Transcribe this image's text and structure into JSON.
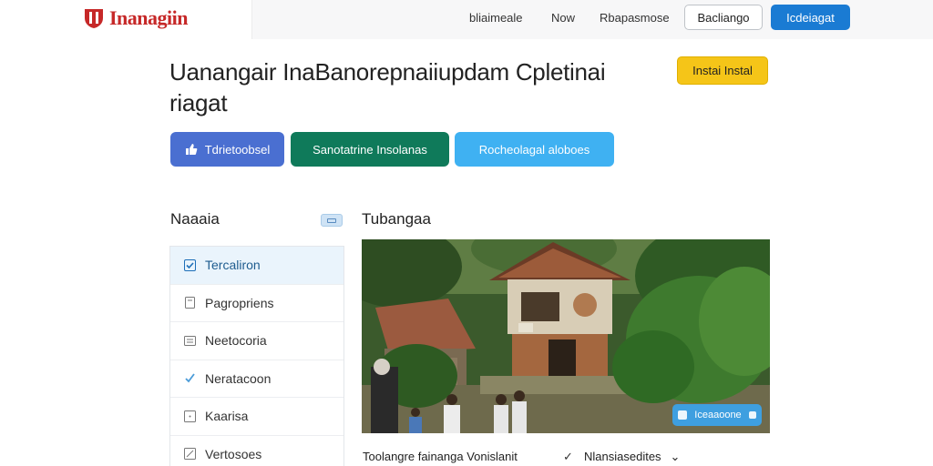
{
  "header": {
    "logo_text": "Inanagiin",
    "nav": [
      "bliaimeale",
      "Now",
      "Rbapasmose"
    ],
    "outline_button": "Bacliango",
    "primary_button": "Icdeiagat"
  },
  "page": {
    "title_line1": "Uanangair InaBanorepnaiiupdam Cpletinai",
    "title_line2": "riagat",
    "install_button": "Instai Instal"
  },
  "actions": [
    {
      "label": "Tdrietoobsel",
      "icon": "thumbs-up-icon",
      "color": "#4a6fd1"
    },
    {
      "label": "Sanotatrine Insolanas",
      "color": "#0f7a5a"
    },
    {
      "label": "Rocheolagal aloboes",
      "color": "#3fb1f2"
    }
  ],
  "sidebar": {
    "heading": "Naaaia",
    "items": [
      {
        "label": "Tercaliron",
        "icon": "checkbox-icon",
        "active": true
      },
      {
        "label": "Pagropriens",
        "icon": "document-icon"
      },
      {
        "label": "Neetocoria",
        "icon": "list-icon"
      },
      {
        "label": "Neratacoon",
        "icon": "check-icon"
      },
      {
        "label": "Kaarisa",
        "icon": "image-icon"
      },
      {
        "label": "Vertosoes",
        "icon": "edit-icon"
      }
    ]
  },
  "content": {
    "heading": "Tubangaa",
    "photo_badge": "Iceaaoone",
    "caption": "Toolangre fainanga Vonislanit",
    "select_value": "Nlansiasedites"
  },
  "colors": {
    "accent_blue": "#1a7bd3",
    "install_yellow": "#f5c518",
    "logo_red": "#c62828"
  }
}
